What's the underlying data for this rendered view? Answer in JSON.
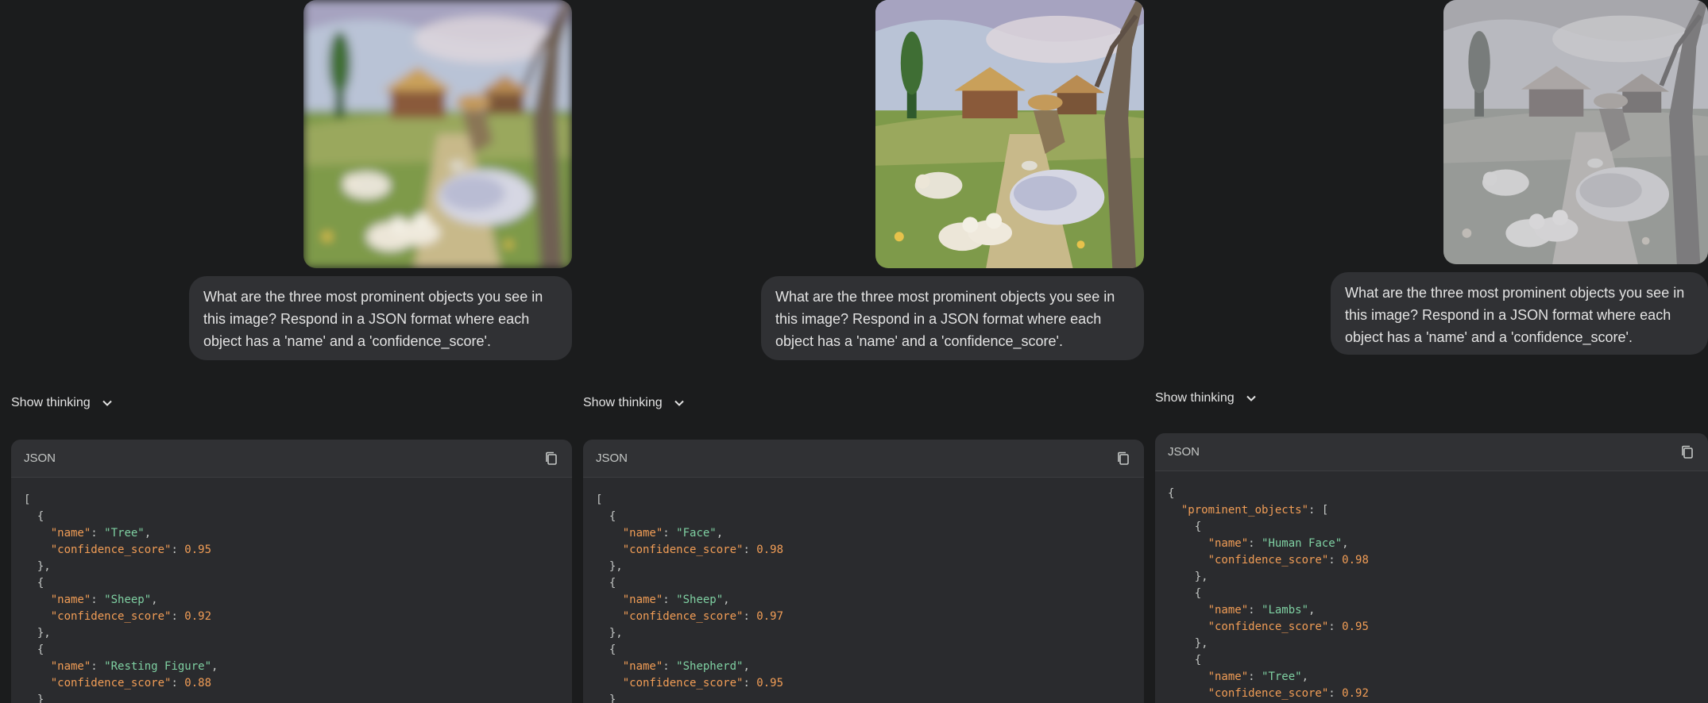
{
  "panels": [
    {
      "prompt": "What are the three most prominent objects you see in this image? Respond in a JSON format where each object has a 'name' and a 'confidence_score'.",
      "show_thinking": "Show thinking",
      "code_lang": "JSON",
      "image_alt": "blurred painting"
    },
    {
      "prompt": "What are the three most prominent objects you see in this image? Respond in a JSON format where each object has a 'name' and a 'confidence_score'.",
      "show_thinking": "Show thinking",
      "code_lang": "JSON",
      "image_alt": "painting"
    },
    {
      "prompt": "What are the three most prominent objects you see in this image? Respond in a JSON format where each object has a 'name' and a 'confidence_score'.",
      "show_thinking": "Show thinking",
      "code_lang": "JSON",
      "image_alt": "desaturated embossed painting"
    }
  ],
  "code_lines": [
    [
      [
        [
          "p",
          "["
        ]
      ],
      [
        [
          "p",
          "  {"
        ]
      ],
      [
        [
          "k",
          "    \"name\""
        ],
        [
          "p",
          ": "
        ],
        [
          "s",
          "\"Tree\""
        ],
        [
          "p",
          ","
        ]
      ],
      [
        [
          "k",
          "    \"confidence_score\""
        ],
        [
          "p",
          ": "
        ],
        [
          "n",
          "0.95"
        ]
      ],
      [
        [
          "p",
          "  },"
        ]
      ],
      [
        [
          "p",
          "  {"
        ]
      ],
      [
        [
          "k",
          "    \"name\""
        ],
        [
          "p",
          ": "
        ],
        [
          "s",
          "\"Sheep\""
        ],
        [
          "p",
          ","
        ]
      ],
      [
        [
          "k",
          "    \"confidence_score\""
        ],
        [
          "p",
          ": "
        ],
        [
          "n",
          "0.92"
        ]
      ],
      [
        [
          "p",
          "  },"
        ]
      ],
      [
        [
          "p",
          "  {"
        ]
      ],
      [
        [
          "k",
          "    \"name\""
        ],
        [
          "p",
          ": "
        ],
        [
          "s",
          "\"Resting Figure\""
        ],
        [
          "p",
          ","
        ]
      ],
      [
        [
          "k",
          "    \"confidence_score\""
        ],
        [
          "p",
          ": "
        ],
        [
          "n",
          "0.88"
        ]
      ],
      [
        [
          "p",
          "  }"
        ]
      ]
    ],
    [
      [
        [
          "p",
          "["
        ]
      ],
      [
        [
          "p",
          "  {"
        ]
      ],
      [
        [
          "k",
          "    \"name\""
        ],
        [
          "p",
          ": "
        ],
        [
          "s",
          "\"Face\""
        ],
        [
          "p",
          ","
        ]
      ],
      [
        [
          "k",
          "    \"confidence_score\""
        ],
        [
          "p",
          ": "
        ],
        [
          "n",
          "0.98"
        ]
      ],
      [
        [
          "p",
          "  },"
        ]
      ],
      [
        [
          "p",
          "  {"
        ]
      ],
      [
        [
          "k",
          "    \"name\""
        ],
        [
          "p",
          ": "
        ],
        [
          "s",
          "\"Sheep\""
        ],
        [
          "p",
          ","
        ]
      ],
      [
        [
          "k",
          "    \"confidence_score\""
        ],
        [
          "p",
          ": "
        ],
        [
          "n",
          "0.97"
        ]
      ],
      [
        [
          "p",
          "  },"
        ]
      ],
      [
        [
          "p",
          "  {"
        ]
      ],
      [
        [
          "k",
          "    \"name\""
        ],
        [
          "p",
          ": "
        ],
        [
          "s",
          "\"Shepherd\""
        ],
        [
          "p",
          ","
        ]
      ],
      [
        [
          "k",
          "    \"confidence_score\""
        ],
        [
          "p",
          ": "
        ],
        [
          "n",
          "0.95"
        ]
      ],
      [
        [
          "p",
          "  }"
        ]
      ]
    ],
    [
      [
        [
          "p",
          "{"
        ]
      ],
      [
        [
          "k",
          "  \"prominent_objects\""
        ],
        [
          "p",
          ": ["
        ]
      ],
      [
        [
          "p",
          "    {"
        ]
      ],
      [
        [
          "k",
          "      \"name\""
        ],
        [
          "p",
          ": "
        ],
        [
          "s",
          "\"Human Face\""
        ],
        [
          "p",
          ","
        ]
      ],
      [
        [
          "k",
          "      \"confidence_score\""
        ],
        [
          "p",
          ": "
        ],
        [
          "n",
          "0.98"
        ]
      ],
      [
        [
          "p",
          "    },"
        ]
      ],
      [
        [
          "p",
          "    {"
        ]
      ],
      [
        [
          "k",
          "      \"name\""
        ],
        [
          "p",
          ": "
        ],
        [
          "s",
          "\"Lambs\""
        ],
        [
          "p",
          ","
        ]
      ],
      [
        [
          "k",
          "      \"confidence_score\""
        ],
        [
          "p",
          ": "
        ],
        [
          "n",
          "0.95"
        ]
      ],
      [
        [
          "p",
          "    },"
        ]
      ],
      [
        [
          "p",
          "    {"
        ]
      ],
      [
        [
          "k",
          "      \"name\""
        ],
        [
          "p",
          ": "
        ],
        [
          "s",
          "\"Tree\""
        ],
        [
          "p",
          ","
        ]
      ],
      [
        [
          "k",
          "      \"confidence_score\""
        ],
        [
          "p",
          ": "
        ],
        [
          "n",
          "0.92"
        ]
      ],
      [
        [
          "p",
          "    }"
        ]
      ]
    ]
  ]
}
